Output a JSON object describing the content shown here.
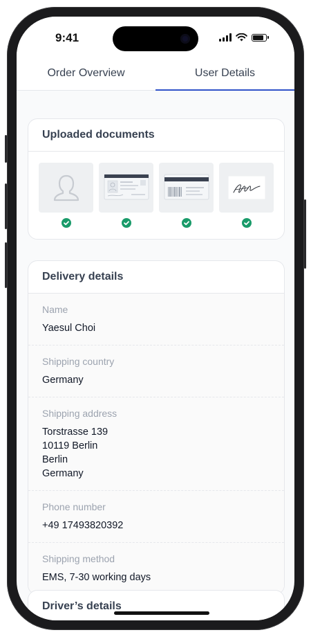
{
  "status": {
    "time": "9:41"
  },
  "tabs": [
    {
      "label": "Order Overview",
      "active": false
    },
    {
      "label": "User Details",
      "active": true
    }
  ],
  "uploaded": {
    "title": "Uploaded documents",
    "items": [
      {
        "icon": "profile-photo-icon",
        "status": "verified"
      },
      {
        "icon": "id-card-front-icon",
        "status": "verified"
      },
      {
        "icon": "id-card-back-icon",
        "status": "verified"
      },
      {
        "icon": "signature-icon",
        "status": "verified"
      }
    ]
  },
  "delivery": {
    "title": "Delivery details",
    "name_label": "Name",
    "name_value": "Yaesul Choi",
    "country_label": "Shipping country",
    "country_value": "Germany",
    "address_label": "Shipping address",
    "address_lines": [
      "Torstrasse 139",
      "10119 Berlin",
      "Berlin",
      "Germany"
    ],
    "phone_label": "Phone number",
    "phone_value": "+49 17493820392",
    "method_label": "Shipping method",
    "method_value": "EMS, 7-30 working days"
  },
  "driver": {
    "title": "Driver’s details"
  },
  "colors": {
    "accent": "#2f52c9",
    "success": "#1a9b6a",
    "text": "#111827",
    "muted": "#9ca3af"
  }
}
